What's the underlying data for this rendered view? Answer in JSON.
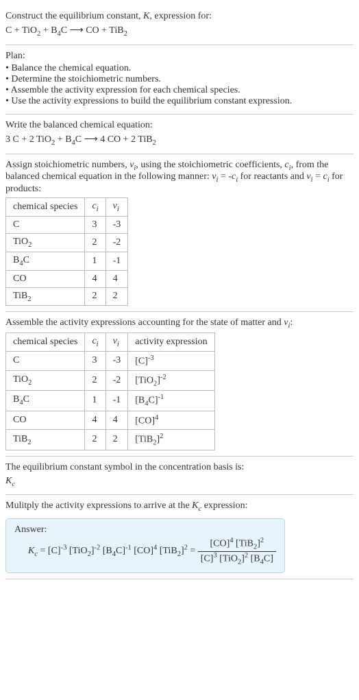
{
  "sec1": {
    "prompt": "Construct the equilibrium constant, K, expression for:",
    "equation": "C + TiO₂ + B₄C ⟶ CO + TiB₂"
  },
  "sec2": {
    "title": "Plan:",
    "bullets": [
      "Balance the chemical equation.",
      "Determine the stoichiometric numbers.",
      "Assemble the activity expression for each chemical species.",
      "Use the activity expressions to build the equilibrium constant expression."
    ]
  },
  "sec3": {
    "prompt": "Write the balanced chemical equation:",
    "equation": "3 C + 2 TiO₂ + B₄C ⟶ 4 CO + 2 TiB₂"
  },
  "sec4": {
    "prompt_a": "Assign stoichiometric numbers, ",
    "prompt_b": ", using the stoichiometric coefficients, ",
    "prompt_c": ", from the balanced chemical equation in the following manner: ",
    "prompt_d": " for reactants and ",
    "prompt_e": " for products:",
    "headers": [
      "chemical species",
      "cᵢ",
      "νᵢ"
    ],
    "rows": [
      [
        "C",
        "3",
        "-3"
      ],
      [
        "TiO₂",
        "2",
        "-2"
      ],
      [
        "B₄C",
        "1",
        "-1"
      ],
      [
        "CO",
        "4",
        "4"
      ],
      [
        "TiB₂",
        "2",
        "2"
      ]
    ]
  },
  "sec5": {
    "prompt": "Assemble the activity expressions accounting for the state of matter and νᵢ:",
    "headers": [
      "chemical species",
      "cᵢ",
      "νᵢ",
      "activity expression"
    ],
    "rows": [
      {
        "sp": "C",
        "c": "3",
        "v": "-3",
        "ae_base": "[C]",
        "ae_exp": "-3"
      },
      {
        "sp": "TiO₂",
        "c": "2",
        "v": "-2",
        "ae_base": "[TiO₂]",
        "ae_exp": "-2"
      },
      {
        "sp": "B₄C",
        "c": "1",
        "v": "-1",
        "ae_base": "[B₄C]",
        "ae_exp": "-1"
      },
      {
        "sp": "CO",
        "c": "4",
        "v": "4",
        "ae_base": "[CO]",
        "ae_exp": "4"
      },
      {
        "sp": "TiB₂",
        "c": "2",
        "v": "2",
        "ae_base": "[TiB₂]",
        "ae_exp": "2"
      }
    ]
  },
  "sec6": {
    "prompt": "The equilibrium constant symbol in the concentration basis is:",
    "symbol": "K_c"
  },
  "sec7": {
    "prompt": "Mulitply the activity expressions to arrive at the K_c expression:",
    "answer_label": "Answer:",
    "lhs": "K_c = ",
    "terms": "[C]⁻³ [TiO₂]⁻² [B₄C]⁻¹ [CO]⁴ [TiB₂]² = ",
    "num": "[CO]⁴ [TiB₂]²",
    "den": "[C]³ [TiO₂]² [B₄C]"
  }
}
